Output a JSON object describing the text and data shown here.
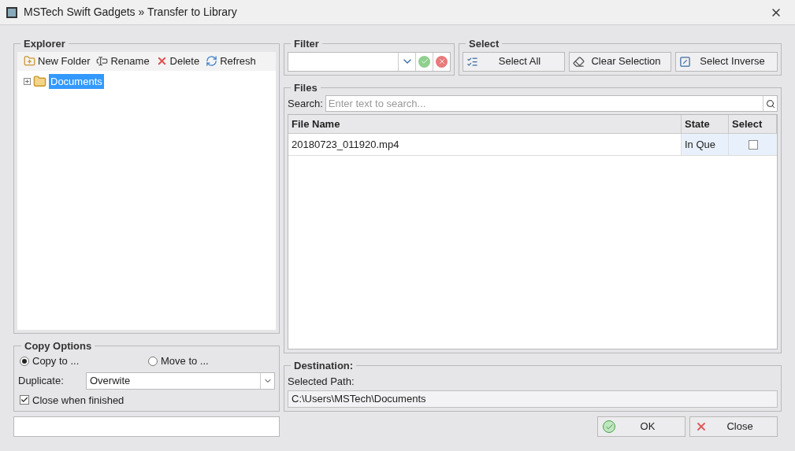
{
  "window": {
    "title": "MSTech Swift Gadgets » Transfer to Library"
  },
  "explorer": {
    "title": "Explorer",
    "toolbar": [
      {
        "label": "New Folder",
        "kind": "new-folder"
      },
      {
        "label": "Rename",
        "kind": "rename"
      },
      {
        "label": "Delete",
        "kind": "delete"
      },
      {
        "label": "Refresh",
        "kind": "refresh"
      }
    ],
    "tree": [
      {
        "label": "Documents",
        "selected": true,
        "expanded": false
      }
    ]
  },
  "filter": {
    "title": "Filter"
  },
  "select": {
    "title": "Select",
    "buttons": [
      {
        "label": "Select All",
        "kind": "all"
      },
      {
        "label": "Clear Selection",
        "kind": "clear"
      },
      {
        "label": "Select Inverse",
        "kind": "inverse"
      }
    ]
  },
  "files": {
    "title": "Files",
    "search_label": "Search:",
    "search_placeholder": "Enter text to search...",
    "columns": [
      "File Name",
      "State",
      "Select"
    ],
    "rows": [
      {
        "file_name": "20180723_011920.mp4",
        "state": "In Que",
        "checked": false
      }
    ]
  },
  "copy_options": {
    "title": "Copy Options",
    "options": [
      {
        "label": "Copy to ...",
        "selected": true
      },
      {
        "label": "Move to ...",
        "selected": false
      }
    ],
    "duplicate_label": "Duplicate:",
    "duplicate_value": "Overwite",
    "close_when_finished": {
      "label": "Close when finished",
      "checked": true
    }
  },
  "destination": {
    "title": "Destination:",
    "path_label": "Selected Path:",
    "path": "C:\\Users\\MSTech\\Documents"
  },
  "buttons": [
    {
      "label": "OK",
      "kind": "ok"
    },
    {
      "label": "Close",
      "kind": "close"
    }
  ]
}
